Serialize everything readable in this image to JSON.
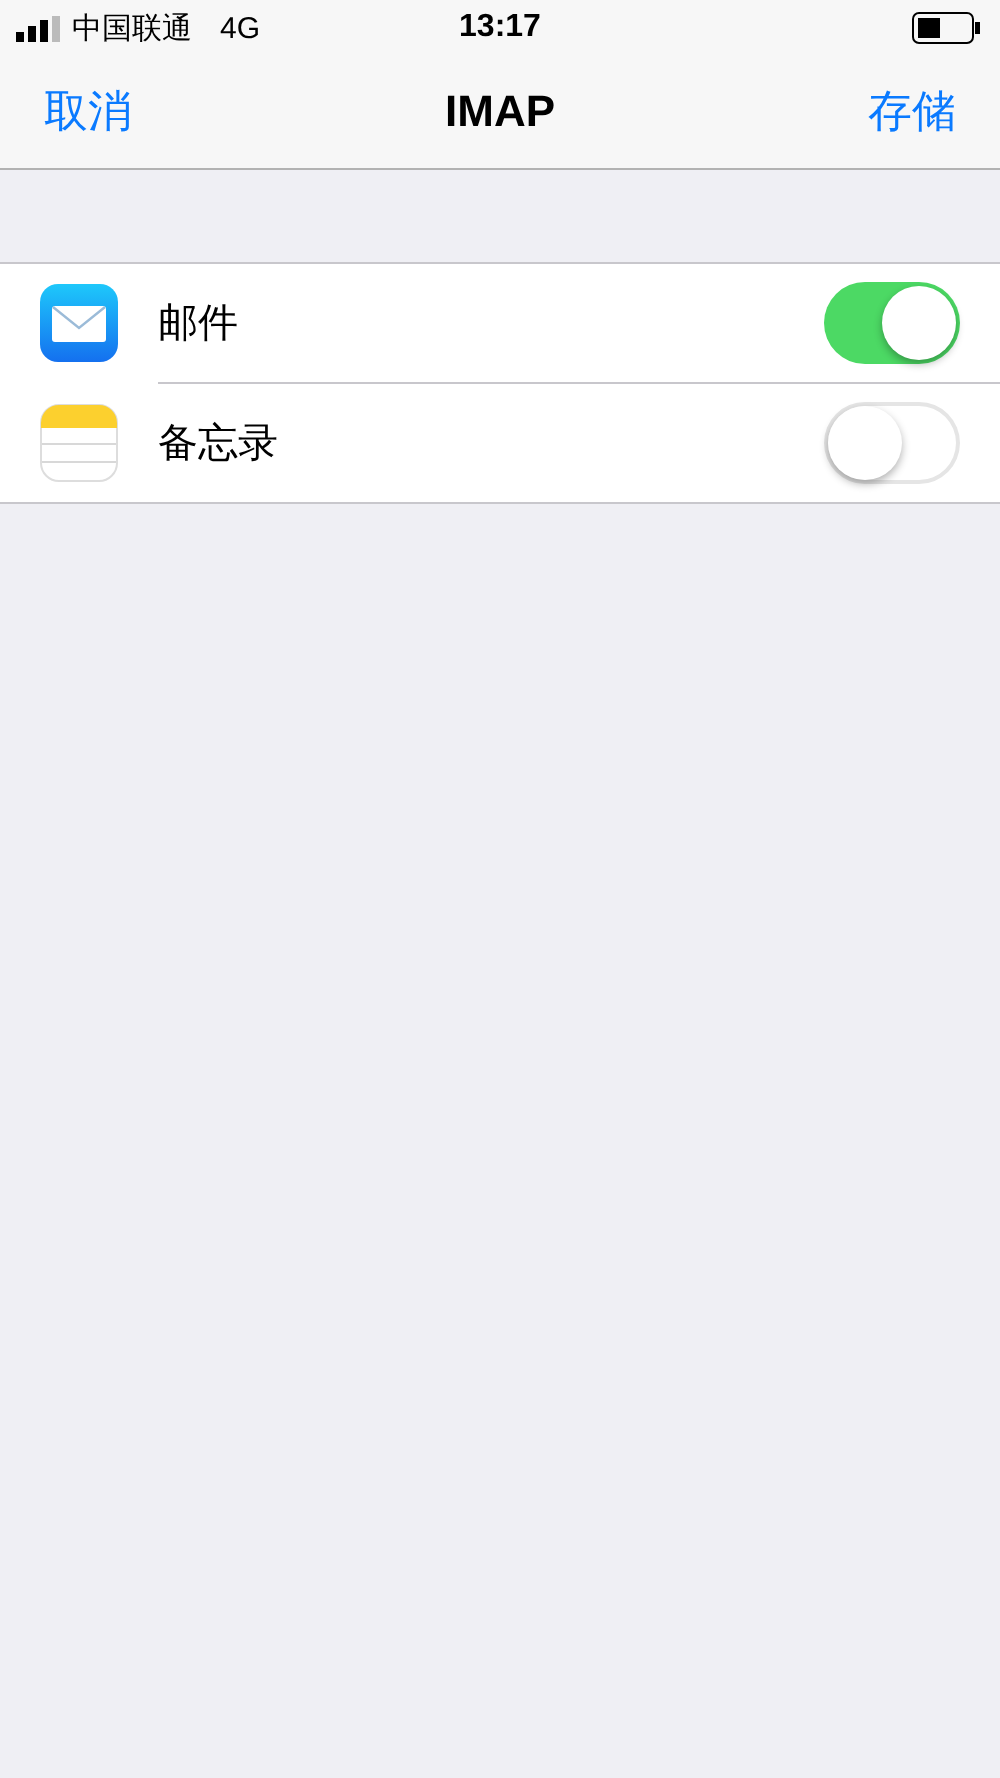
{
  "status_bar": {
    "carrier": "中国联通",
    "network": "4G",
    "time": "13:17"
  },
  "nav_bar": {
    "cancel": "取消",
    "title": "IMAP",
    "save": "存储"
  },
  "items": [
    {
      "kind": "mail",
      "label": "邮件",
      "on": true
    },
    {
      "kind": "notes",
      "label": "备忘录",
      "on": false
    }
  ]
}
